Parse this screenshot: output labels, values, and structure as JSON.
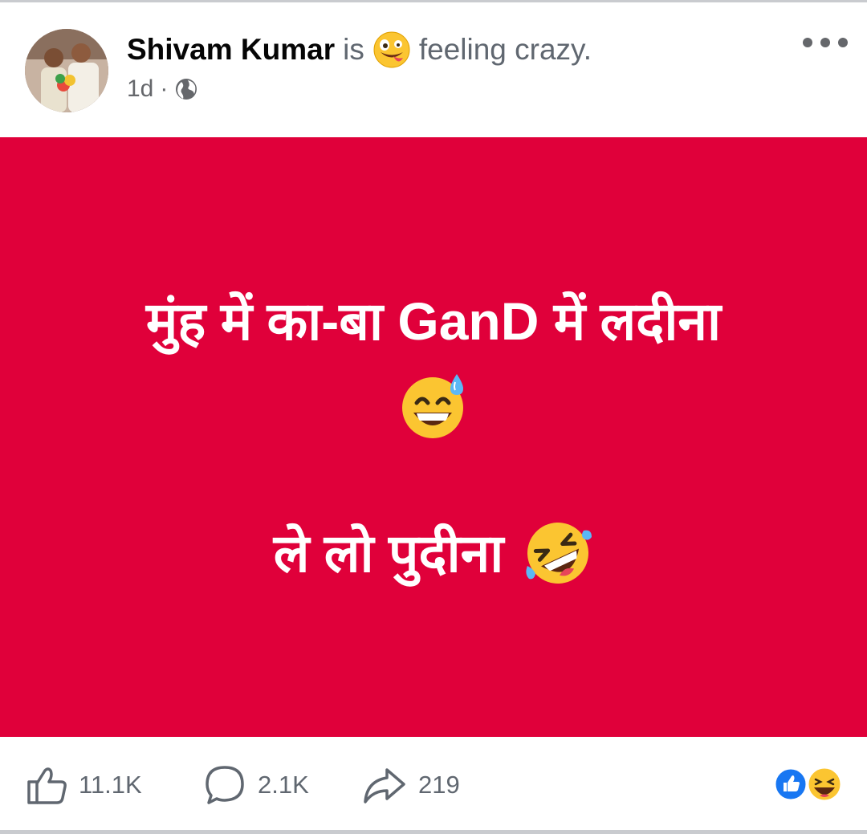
{
  "post": {
    "author": "Shivam Kumar",
    "is_word": "is",
    "feeling_emoji": "crazy-face-emoji",
    "feeling_text": "feeling crazy.",
    "time": "1d",
    "separator": "·",
    "audience_icon": "globe-icon",
    "more_icon": "more-options-icon",
    "body": {
      "background_color": "#e0003a",
      "line1": "मुंह में का-बा GanD में लदीना",
      "line1_emoji": "grinning-sweat-emoji",
      "line2": "ले लो पुदीना",
      "line2_emoji": "rolling-laughing-emoji"
    }
  },
  "footer": {
    "like_icon": "thumbs-up-icon",
    "like_count": "11.1K",
    "comment_icon": "comment-icon",
    "comment_count": "2.1K",
    "share_icon": "share-icon",
    "share_count": "219",
    "reactions": [
      "like-reaction-icon",
      "haha-reaction-icon"
    ]
  },
  "colors": {
    "accent_blue": "#1877f2",
    "text_primary": "#050505",
    "text_secondary": "#65676b",
    "post_red": "#e0003a"
  }
}
